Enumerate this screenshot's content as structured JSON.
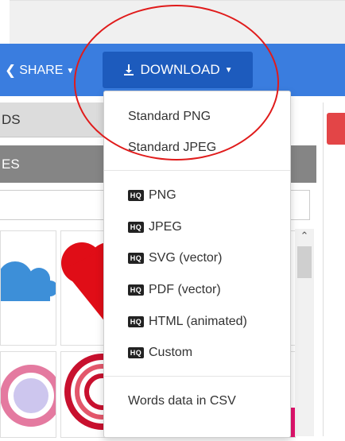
{
  "toolbar": {
    "share_label": "SHARE",
    "download_label": "DOWNLOAD"
  },
  "tabs": {
    "tab1_label": "DS",
    "tab2_label": "ES"
  },
  "menu": {
    "standard": [
      {
        "label": "Standard PNG"
      },
      {
        "label": "Standard JPEG"
      }
    ],
    "hq_badge": "HQ",
    "hq": [
      {
        "label": "PNG"
      },
      {
        "label": "JPEG"
      },
      {
        "label": "SVG (vector)"
      },
      {
        "label": "PDF (vector)"
      },
      {
        "label": "HTML (animated)"
      },
      {
        "label": "Custom"
      }
    ],
    "csv_label": "Words data in CSV"
  },
  "colors": {
    "bar": "#3a7ddf",
    "button": "#1d5bbd",
    "annotation": "#e01b1b"
  },
  "icons": {
    "share": "share-icon",
    "download": "download-icon",
    "caret": "caret-down-icon",
    "hq": "hq-badge-icon",
    "scroll_up": "scroll-up-arrow-icon"
  }
}
